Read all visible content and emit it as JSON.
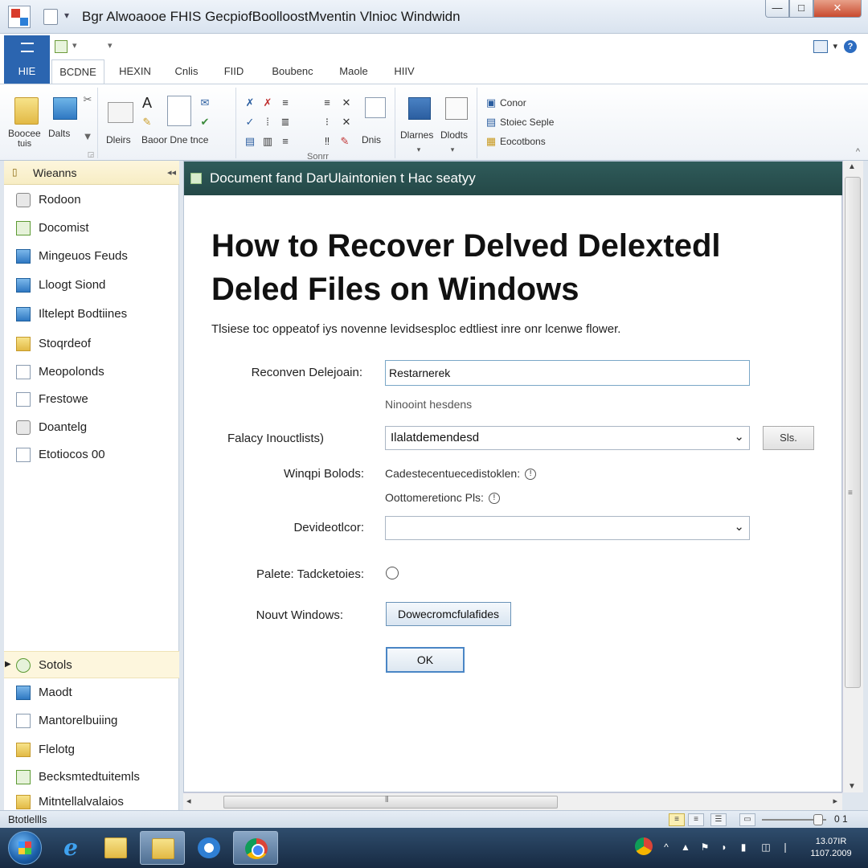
{
  "window": {
    "title": "Bgr Alwoaooe FHIS GecpiofBoolloostMventin Vlnioc Windwidn",
    "min_glyph": "—",
    "max_glyph": "□",
    "close_glyph": "✕"
  },
  "quick_toolbar": {
    "arrow": "▾",
    "help_glyph": "?"
  },
  "tabs": [
    {
      "label": "HIE"
    },
    {
      "label": "BCDNE"
    },
    {
      "label": "HEXIN"
    },
    {
      "label": "Cnlis"
    },
    {
      "label": "FIID"
    },
    {
      "label": "Boubenc"
    },
    {
      "label": "Maole"
    },
    {
      "label": "HIIV"
    }
  ],
  "ribbon": {
    "group1": {
      "btn1": "Boocee",
      "btn1b": "tuis",
      "btn2": "Dalts"
    },
    "group2": {
      "btn1": "Dleirs",
      "btn2": "Baoor Dne tnce"
    },
    "group3": {
      "title": "Sonrr",
      "label": "Dnis"
    },
    "group4": {
      "btn1": "Dlarnes",
      "btn2": "Dlodts"
    },
    "group5": {
      "item1": "Conor",
      "item2": "Stoiec Seple",
      "item3": "Eocotbons"
    }
  },
  "sidebar": {
    "header": "Wieanns",
    "items": [
      {
        "label": "Rodoon"
      },
      {
        "label": "Docomist"
      },
      {
        "label": "Mingeuos Feuds"
      },
      {
        "label": "Lloogt Siond"
      },
      {
        "label": "Iltelept Bodtiines"
      },
      {
        "label": "Stoqrdeof"
      },
      {
        "label": "Meopolonds"
      },
      {
        "label": "Frestowe"
      },
      {
        "label": "Doantelg"
      },
      {
        "label": "Etotiocos 00"
      }
    ],
    "bottom_items": [
      {
        "label": "Sotols"
      },
      {
        "label": "Maodt"
      },
      {
        "label": "Mantorelbuiing"
      },
      {
        "label": "Flelotg"
      },
      {
        "label": "Becksmtedtuitemls"
      },
      {
        "label": "Mitntellalvalaios"
      }
    ]
  },
  "pane": {
    "header": "Document fand DarUlaintonien t Hac seatyy",
    "title": "How to Recover Delved Delextedl Deled Files on Windows",
    "description": "Tlsiese toc oppeatof iys novenne levidsesploc edtliest inre onr lcenwe flower."
  },
  "form": {
    "field1_label": "Reconven Delejoain:",
    "field1_value": "Restarnerek",
    "field1_hint": "Ninooint hesdens",
    "field2_label": "Falacy Inouctlists)",
    "field2_value": "Ilalatdemendesd",
    "field2_button": "Sls.",
    "field3_label": "Winqpi Bolods:",
    "field3_info1": "Cadestecentuecedistoklen:",
    "field3_info2": "Oottomeretionc Pls:",
    "field4_label": "Devideotlcor:",
    "field4_value": "",
    "field5_label": "Palete: Tadcketoies:",
    "field6_label": "Nouvt Windows:",
    "field6_button": "Dowecromcfulafides",
    "ok_button": "OK"
  },
  "status": {
    "left": "Btotlellls",
    "zoom": "0 1"
  },
  "taskbar": {
    "clock_time": "13.07IR",
    "clock_date": "1107.2009"
  }
}
